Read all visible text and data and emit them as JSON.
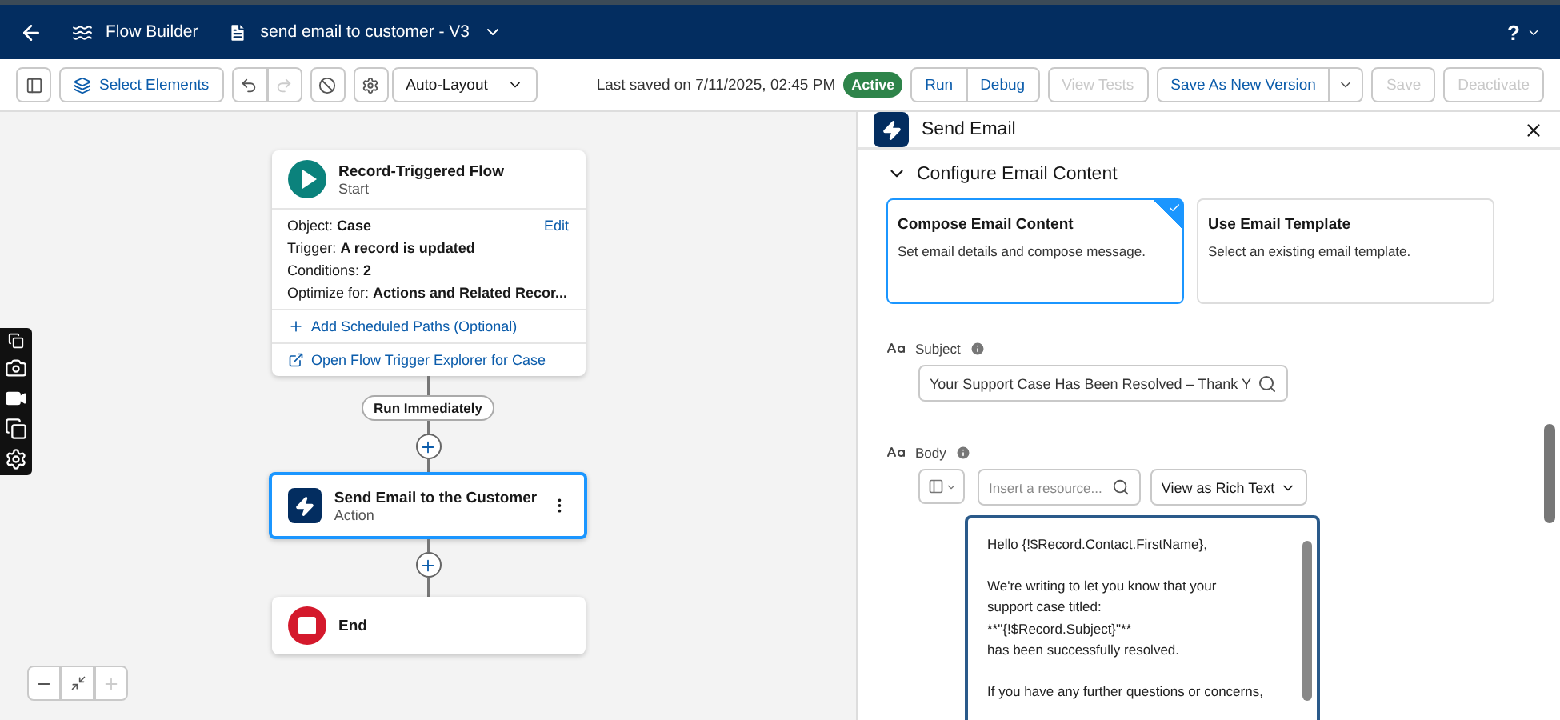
{
  "header": {
    "app_title": "Flow Builder",
    "flow_name": "send email to customer - V3",
    "help": "?"
  },
  "toolbar": {
    "select_elements": "Select Elements",
    "layout": "Auto-Layout",
    "last_saved": "Last saved on 7/11/2025, 02:45 PM",
    "status": "Active",
    "buttons": [
      {
        "label": "Run",
        "kind": "left",
        "disabled": false
      },
      {
        "label": "Debug",
        "kind": "right",
        "disabled": false
      },
      {
        "label": "View Tests",
        "kind": "single",
        "disabled": true
      },
      {
        "label": "Save As New Version",
        "kind": "split",
        "disabled": false
      },
      {
        "label": "Save",
        "kind": "single",
        "disabled": true
      },
      {
        "label": "Deactivate",
        "kind": "single",
        "disabled": true
      }
    ]
  },
  "start_node": {
    "title": "Record-Triggered Flow",
    "subtitle": "Start",
    "edit": "Edit",
    "fields": [
      {
        "label": "Object:",
        "value": "Case"
      },
      {
        "label": "Trigger:",
        "value": "A record is updated"
      },
      {
        "label": "Conditions:",
        "value": "2"
      },
      {
        "label": "Optimize for:",
        "value": "Actions and Related Recor..."
      }
    ],
    "links": [
      {
        "kind": "add",
        "label": "Add Scheduled Paths (Optional)"
      },
      {
        "kind": "external",
        "label": "Open Flow Trigger Explorer for Case"
      }
    ]
  },
  "path_label": "Run Immediately",
  "action_node": {
    "title": "Send Email to the Customer",
    "subtitle": "Action",
    "selected": true
  },
  "end_node": {
    "title": "End"
  },
  "panel": {
    "title": "Send Email",
    "section": {
      "title": "Configure Email Content",
      "expanded": true
    },
    "options": [
      {
        "title": "Compose Email Content",
        "description": "Set email details and compose message.",
        "selected": true
      },
      {
        "title": "Use Email Template",
        "description": "Select an existing email template.",
        "selected": false
      }
    ],
    "subject": {
      "label": "Subject",
      "value": "Your Support Case Has Been Resolved – Thank Y"
    },
    "body": {
      "label": "Body",
      "resource_placeholder": "Insert a resource...",
      "view_mode": "View as Rich Text",
      "paragraphs": [
        [
          "Hello {!$Record.Contact.FirstName},"
        ],
        [
          "We're writing to let you know that your",
          "support case titled:",
          "**\"{!$Record.Subject}\"**",
          "has been successfully resolved."
        ],
        [
          "If you have any further questions or concerns,"
        ]
      ]
    }
  }
}
